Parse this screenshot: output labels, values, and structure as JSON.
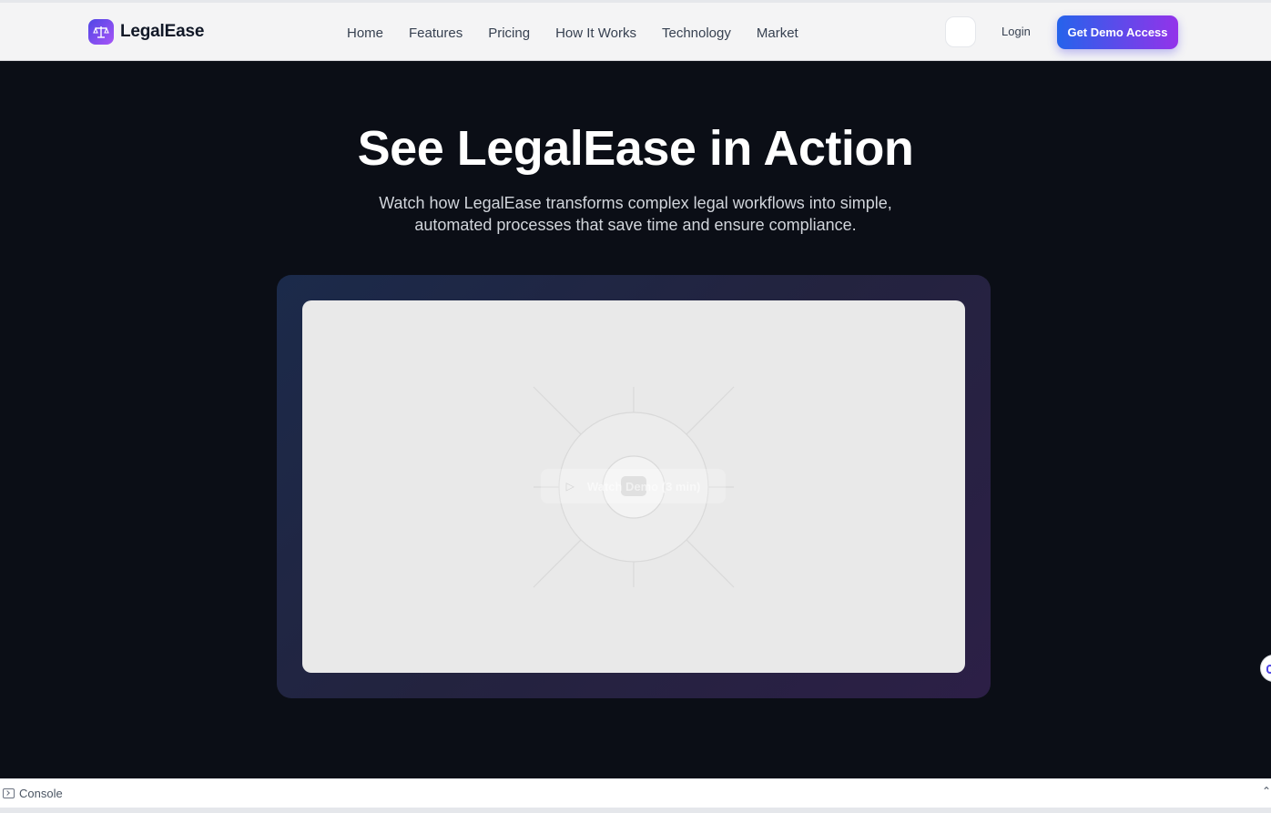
{
  "brand": {
    "name": "LegalEase",
    "logo_icon": "scales-icon"
  },
  "nav": {
    "links": [
      "Home",
      "Features",
      "Pricing",
      "How It Works",
      "Technology",
      "Market"
    ],
    "login_label": "Login",
    "demo_button_label": "Get Demo Access"
  },
  "hero": {
    "title": "See LegalEase in Action",
    "subtitle": "Watch how LegalEase transforms complex legal workflows into simple, automated processes that save time and ensure compliance.",
    "video": {
      "watch_label": "Watch Demo (3 min)",
      "play_icon": "play-icon"
    }
  },
  "console": {
    "label": "Console",
    "icon": "terminal-icon",
    "toggle_icon": "chevron-up-icon"
  },
  "colors": {
    "accent_start": "#2563eb",
    "accent_end": "#9333ea",
    "hero_bg": "#0b0e16",
    "navbar_bg": "#f4f4f5"
  }
}
